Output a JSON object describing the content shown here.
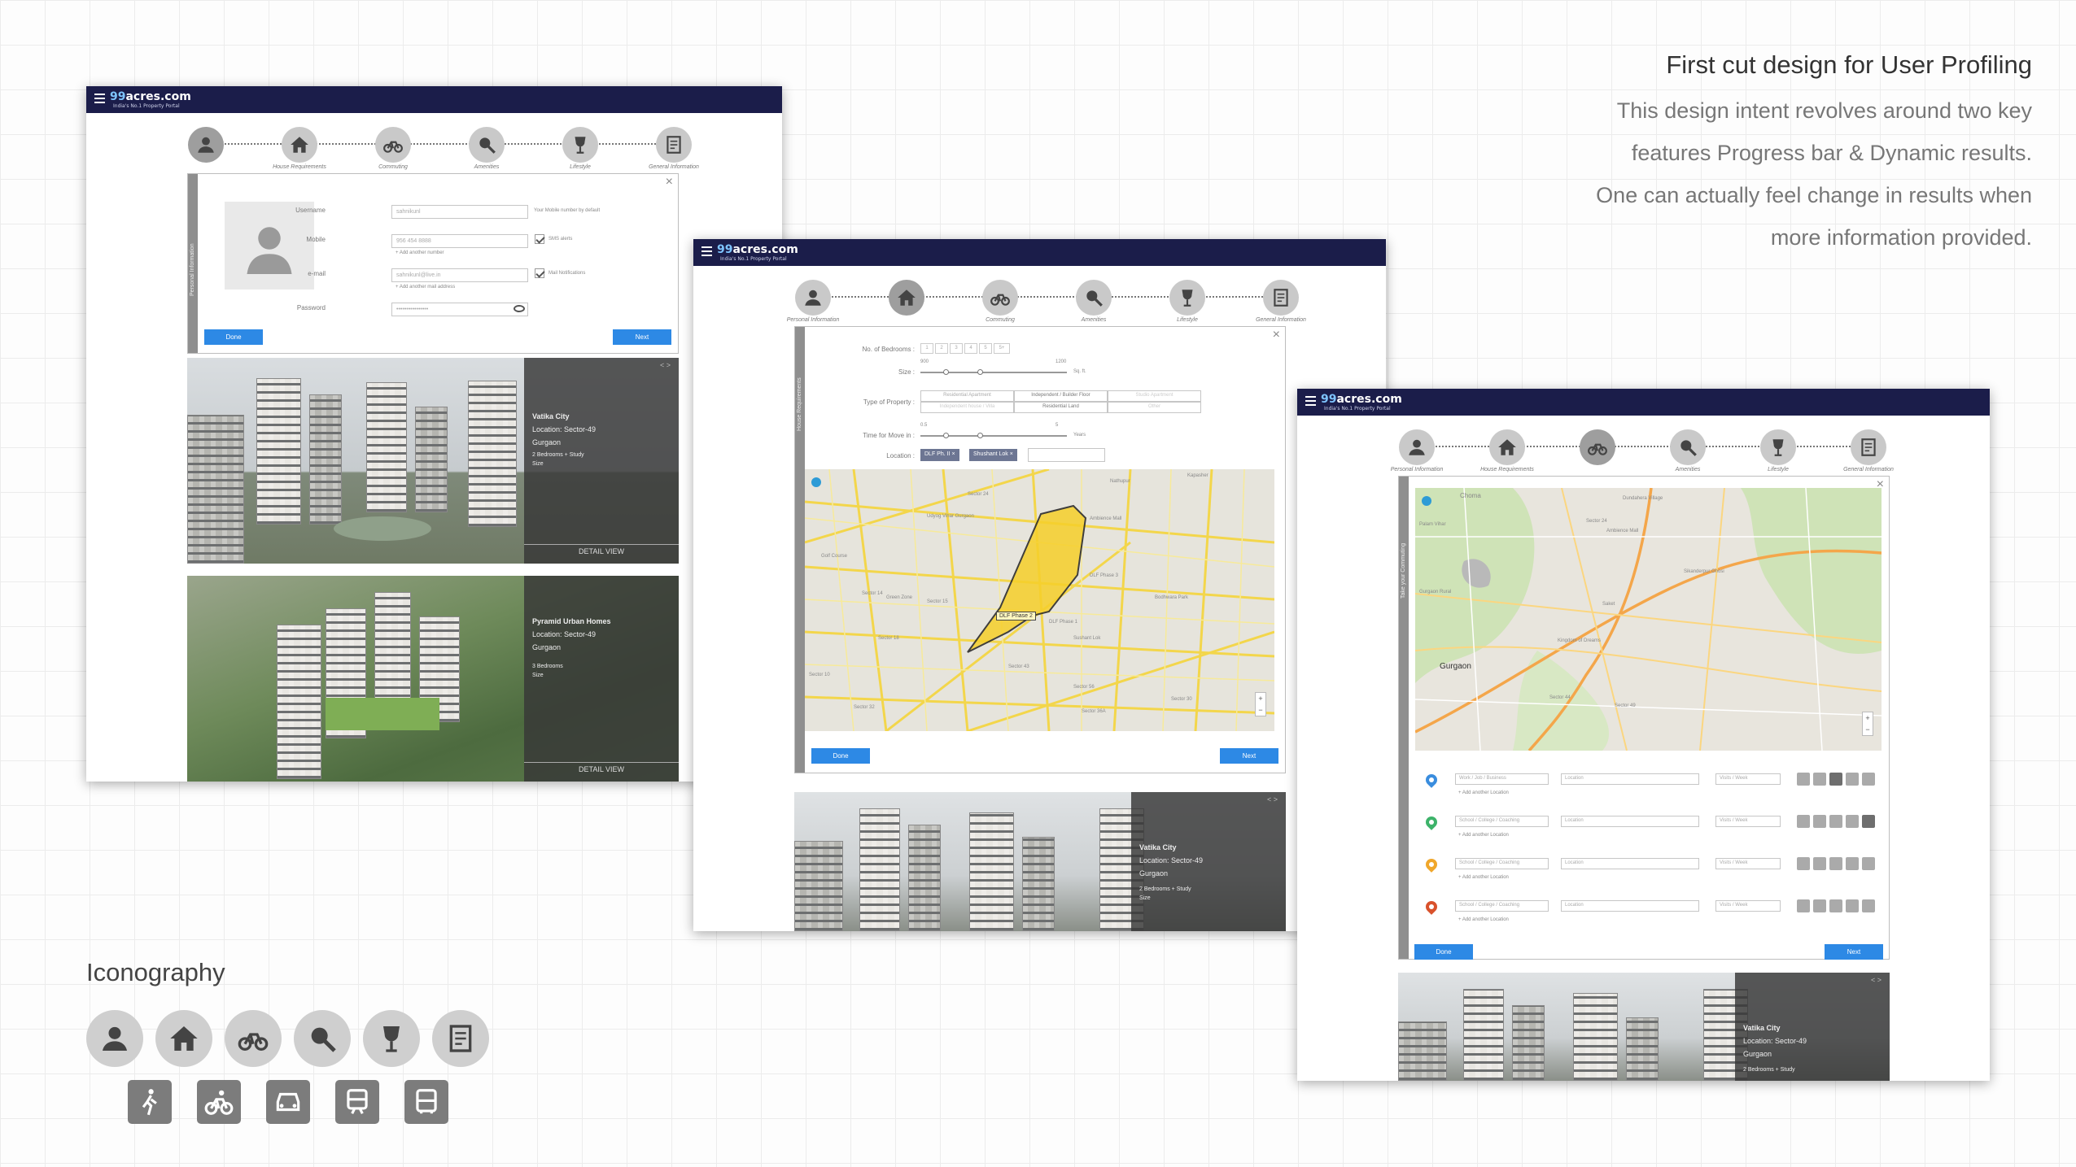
{
  "brand": {
    "logo_prefix": "99",
    "logo_text": "acres.com",
    "tagline": "India's No.1 Property Portal"
  },
  "description": {
    "title": "First cut design for User Profiling",
    "lines": [
      "This design intent revolves around two key",
      "features Progress bar & Dynamic results.",
      "One can actually feel change in results when",
      "more information provided."
    ]
  },
  "steps": {
    "personal": "Personal Information",
    "house": "House Requirements",
    "commuting": "Commuting",
    "amenities": "Amenities",
    "lifestyle": "Lifestyle",
    "general": "General Information"
  },
  "buttons": {
    "done": "Done",
    "next": "Next"
  },
  "screen1": {
    "panel_label": "Personal Information",
    "username_label": "Username",
    "username_value": "sahnikunl",
    "username_hint": "Your Mobile number by default",
    "mobile_label": "Mobile",
    "mobile_value": "956 454 8888",
    "mobile_check": "SMS alerts",
    "add_number": "Add another number",
    "email_label": "e-mail",
    "email_value": "sahnikunl@live.in",
    "email_check": "Mail Notifications",
    "add_email": "Add another mail address",
    "password_label": "Password",
    "password_value": "••••••••••••••••"
  },
  "screen2": {
    "panel_label": "House Requirements",
    "bedrooms_label": "No. of Bedrooms",
    "bedrooms": [
      "1",
      "2",
      "3",
      "4",
      "5",
      "5+"
    ],
    "size_label": "Size",
    "size_min": "900",
    "size_max": "1200",
    "size_unit": "Sq. ft.",
    "type_label": "Type of Property",
    "types": [
      "Residential Apartment",
      "Independent / Builder Floor",
      "Studio Apartment",
      "Independent house / Villa",
      "Residential Land",
      "Other"
    ],
    "move_label": "Time for Move in",
    "move_min": "0.5",
    "move_max": "5",
    "move_unit": "Years",
    "location_label": "Location",
    "chips": [
      "DLF Ph. II",
      "Shushant Lok"
    ],
    "map_label": "DLF Phase 2",
    "map_places": [
      "Kapasher",
      "Nathupur",
      "Sector 24",
      "Ambience Mall",
      "Udyog Vihar Gurgaon",
      "DLF Phase 3",
      "Golf Course",
      "DLF Phase 1",
      "Sector 14",
      "Green Zone",
      "Sector 15",
      "Sushant Lok",
      "Sector 10",
      "Sector 18",
      "Bodhwara Park",
      "Sector 43",
      "Sector 32",
      "Sector 56",
      "Sector 36A",
      "Sector 30"
    ]
  },
  "screen3": {
    "panel_label": "Take your Commuting",
    "map_places": [
      "Choma",
      "Palam Vihar",
      "Dundahera Village",
      "Sector 24",
      "Ambience Mall",
      "Sikanderpur Ghosi",
      "Gurgaon Rural",
      "Gurgaon",
      "Sector 44",
      "Kingdom of Dreams",
      "Saket",
      "Sector 49"
    ],
    "rows": [
      {
        "placeholder": "Work / Job / Business",
        "location": "Location",
        "visits": "Visits / Week",
        "add": "Add another Location",
        "color": "#3a8dde"
      },
      {
        "placeholder": "School / College / Coaching",
        "location": "Location",
        "visits": "Visits / Week",
        "add": "Add another Location",
        "color": "#3db36a"
      },
      {
        "placeholder": "School / College / Coaching",
        "location": "Location",
        "visits": "Visits / Week",
        "add": "Add another Location",
        "color": "#f0a72b"
      },
      {
        "placeholder": "School / College / Coaching",
        "location": "Location",
        "visits": "Visits / Week",
        "add": "Add another Location",
        "color": "#d9522c"
      }
    ]
  },
  "listings": [
    {
      "name": "Vatika City",
      "location": "Location: Sector-49",
      "city": "Gurgaon",
      "config": "2 Bedrooms + Study",
      "size": "Size",
      "cta": "DETAIL VIEW"
    },
    {
      "name": "Pyramid Urban Homes",
      "location": "Location: Sector-49",
      "city": "Gurgaon",
      "config": "3 Bedrooms",
      "size": "Size",
      "cta": "DETAIL VIEW"
    }
  ],
  "iconography": {
    "title": "Iconography",
    "round_icons": [
      "user-icon",
      "home-icon",
      "bicycle-icon",
      "search-icon",
      "wine-glass-icon",
      "document-icon"
    ],
    "transport_icons": [
      "walk-icon",
      "bicycle-icon",
      "car-icon",
      "train-icon",
      "bus-icon"
    ]
  }
}
